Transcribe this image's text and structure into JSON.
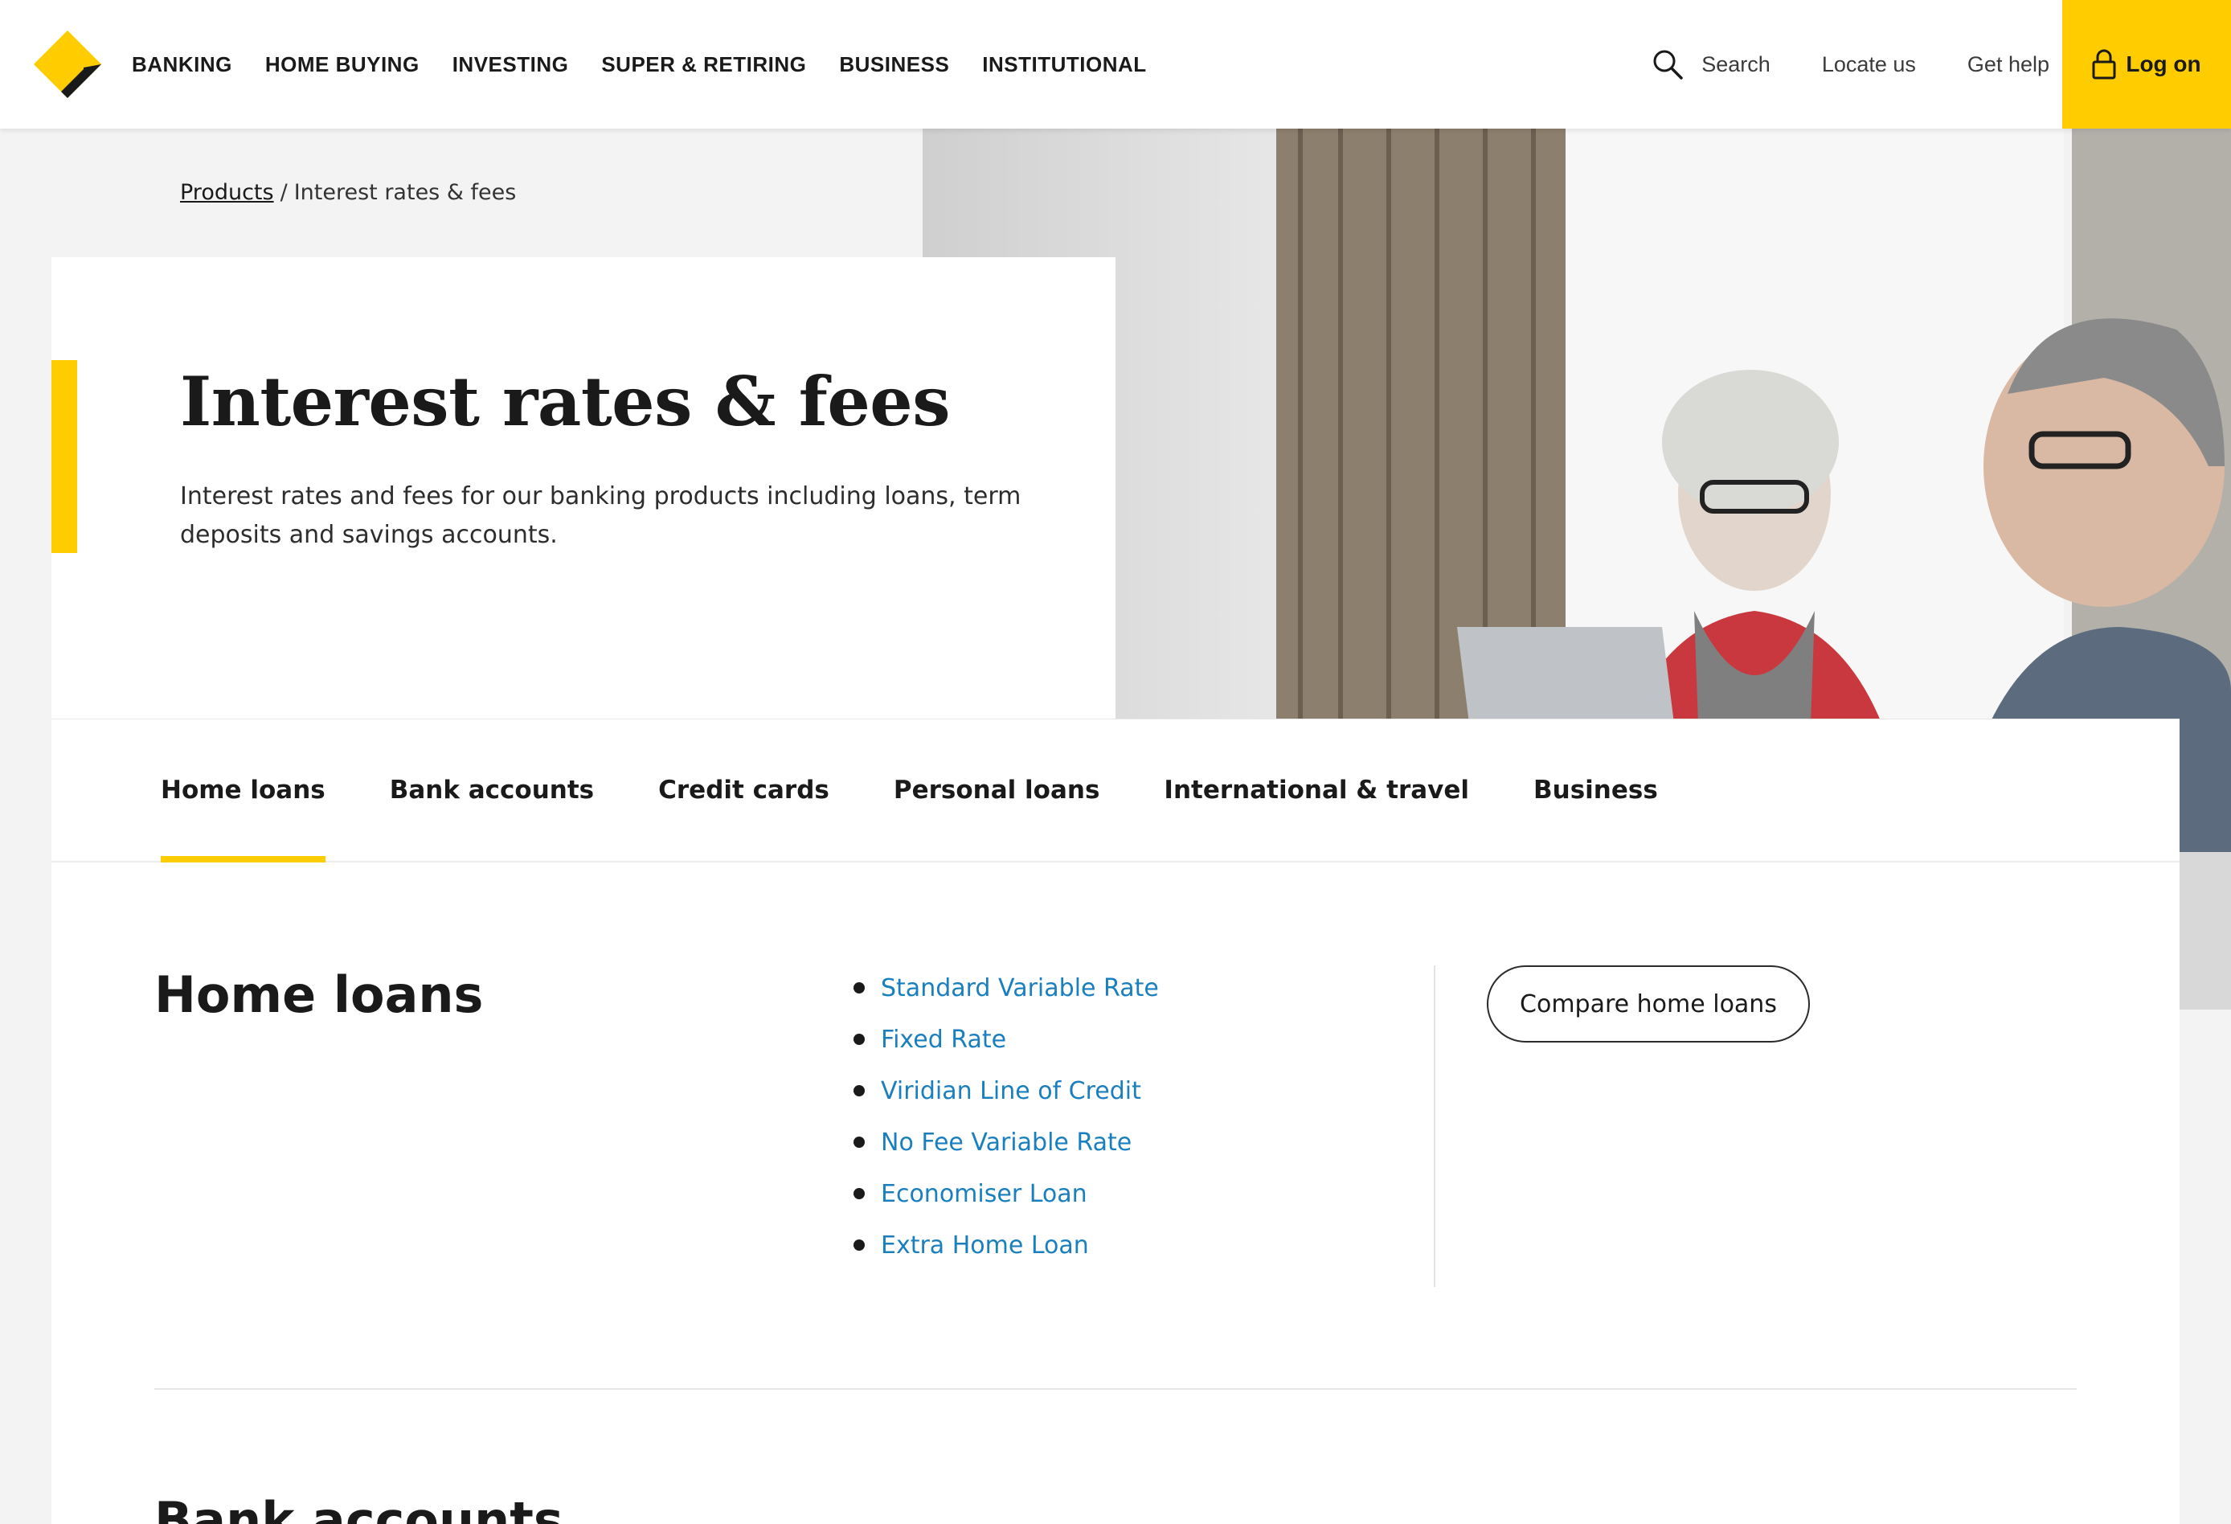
{
  "header": {
    "nav": [
      "BANKING",
      "HOME BUYING",
      "INVESTING",
      "SUPER & RETIRING",
      "BUSINESS",
      "INSTITUTIONAL"
    ],
    "search_label": "Search",
    "locate_label": "Locate us",
    "help_label": "Get help",
    "logon_label": "Log on",
    "brand_color": "#ffcc00"
  },
  "breadcrumb": {
    "products": "Products",
    "separator": "/",
    "current": "Interest rates & fees"
  },
  "hero": {
    "title": "Interest rates & fees",
    "description": "Interest rates and fees for our banking products including loans, term deposits and savings accounts."
  },
  "tabs": [
    {
      "label": "Home loans",
      "active": true
    },
    {
      "label": "Bank accounts",
      "active": false
    },
    {
      "label": "Credit cards",
      "active": false
    },
    {
      "label": "Personal loans",
      "active": false
    },
    {
      "label": "International & travel",
      "active": false
    },
    {
      "label": "Business",
      "active": false
    }
  ],
  "home_loans": {
    "title": "Home loans",
    "links": [
      "Standard Variable Rate",
      "Fixed Rate",
      "Viridian Line of Credit",
      "No Fee Variable Rate",
      "Economiser Loan",
      "Extra Home Loan"
    ],
    "compare_label": "Compare home loans",
    "link_color": "#1a7fbf"
  },
  "next_section": {
    "title": "Bank accounts"
  }
}
